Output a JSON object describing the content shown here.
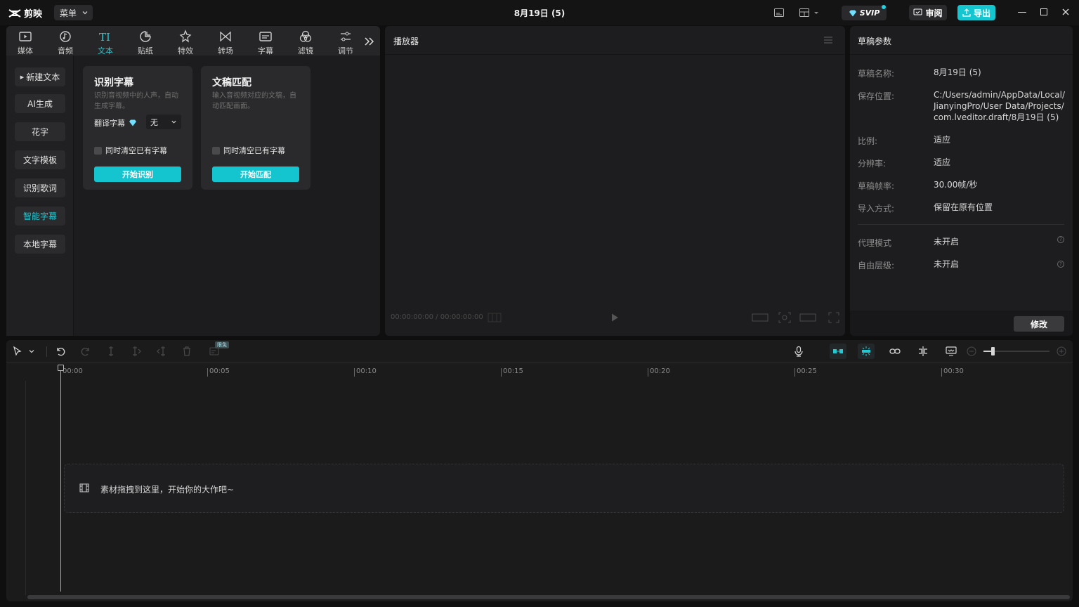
{
  "app": {
    "name": "剪映",
    "menu_label": "菜单",
    "title": "8月19日 (5)"
  },
  "titlebar": {
    "svip_label": "SVIP",
    "review_label": "审阅",
    "export_label": "导出",
    "accent": "#13c6cf"
  },
  "tabs": [
    {
      "label": "媒体",
      "icon": "media-icon"
    },
    {
      "label": "音频",
      "icon": "audio-icon"
    },
    {
      "label": "文本",
      "icon": "text-icon",
      "active": true
    },
    {
      "label": "贴纸",
      "icon": "sticker-icon"
    },
    {
      "label": "特效",
      "icon": "effects-icon"
    },
    {
      "label": "转场",
      "icon": "transition-icon"
    },
    {
      "label": "字幕",
      "icon": "subtitle-icon"
    },
    {
      "label": "滤镜",
      "icon": "filter-icon"
    },
    {
      "label": "调节",
      "icon": "adjust-icon"
    }
  ],
  "side_menu": [
    {
      "label": "新建文本"
    },
    {
      "label": "AI生成"
    },
    {
      "label": "花字"
    },
    {
      "label": "文字模板"
    },
    {
      "label": "识别歌词"
    },
    {
      "label": "智能字幕",
      "active": true
    },
    {
      "label": "本地字幕"
    }
  ],
  "cards": {
    "recognize": {
      "title": "识别字幕",
      "desc": "识别音视频中的人声，自动生成字幕。",
      "translate_label": "翻译字幕",
      "translate_value": "无",
      "clear_label": "同时清空已有字幕",
      "button": "开始识别"
    },
    "match": {
      "title": "文稿匹配",
      "desc": "输入音视频对应的文稿，自动匹配画面。",
      "clear_label": "同时清空已有字幕",
      "button": "开始匹配"
    }
  },
  "player": {
    "title": "播放器",
    "time": "00:00:00:00 / 00:00:00:00"
  },
  "draft": {
    "title": "草稿参数",
    "rows": [
      {
        "label": "草稿名称:",
        "value": "8月19日 (5)"
      },
      {
        "label": "保存位置:",
        "value": "C:/Users/admin/AppData/Local/JianyingPro/User Data/Projects/com.lveditor.draft/8月19日 (5)"
      },
      {
        "label": "比例:",
        "value": "适应"
      },
      {
        "label": "分辨率:",
        "value": "适应"
      },
      {
        "label": "草稿帧率:",
        "value": "30.00帧/秒"
      },
      {
        "label": "导入方式:",
        "value": "保留在原有位置"
      },
      {
        "label": "代理模式",
        "value": "未开启"
      },
      {
        "label": "自由层级:",
        "value": "未开启"
      }
    ],
    "modify_label": "修改"
  },
  "timeline": {
    "ticks": [
      "00:00",
      "00:05",
      "00:10",
      "00:15",
      "00:20",
      "00:25",
      "00:30"
    ],
    "drop_hint": "素材拖拽到这里，开始你的大作吧~",
    "badge": "限免"
  }
}
